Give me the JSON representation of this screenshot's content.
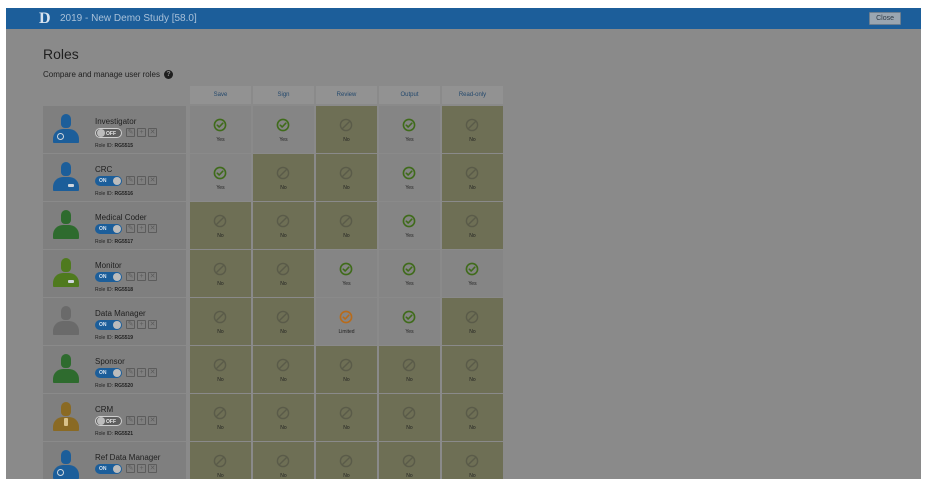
{
  "header": {
    "logo": "D",
    "app_title": "2019 - New Demo Study [58.0]",
    "close_label": "Close"
  },
  "page": {
    "title": "Roles",
    "subtitle": "Compare and manage user roles",
    "help_glyph": "?"
  },
  "columns": [
    "Save",
    "Sign",
    "Review",
    "Output",
    "Read-only"
  ],
  "role_id_prefix": "Role ID:",
  "colors": {
    "accent": "#1c5e9a",
    "yes_check": "#3f6b1a",
    "limited_check": "#b86b1a",
    "no_mark": "#5a5b49"
  },
  "roles": [
    {
      "name": "Investigator",
      "toggle": "OFF",
      "role_id": "RG5515",
      "avatar_color": "#1c5e9a",
      "avatar": "doctor",
      "cells": [
        {
          "status": "yes",
          "label": "Yes"
        },
        {
          "status": "yes",
          "label": "Yes"
        },
        {
          "status": "no",
          "label": "No"
        },
        {
          "status": "yes",
          "label": "Yes"
        },
        {
          "status": "no",
          "label": "No"
        }
      ]
    },
    {
      "name": "CRC",
      "toggle": "ON",
      "role_id": "RG5516",
      "avatar_color": "#1c5e9a",
      "avatar": "badge",
      "cells": [
        {
          "status": "yes",
          "label": "Yes"
        },
        {
          "status": "no",
          "label": "No"
        },
        {
          "status": "no",
          "label": "No"
        },
        {
          "status": "yes",
          "label": "Yes"
        },
        {
          "status": "no",
          "label": "No"
        }
      ]
    },
    {
      "name": "Medical Coder",
      "toggle": "ON",
      "role_id": "RG5517",
      "avatar_color": "#2e6b2e",
      "avatar": "plain",
      "cells": [
        {
          "status": "no",
          "label": "No"
        },
        {
          "status": "no",
          "label": "No"
        },
        {
          "status": "no",
          "label": "No"
        },
        {
          "status": "yes",
          "label": "Yes"
        },
        {
          "status": "no",
          "label": "No"
        }
      ]
    },
    {
      "name": "Monitor",
      "toggle": "ON",
      "role_id": "RG5518",
      "avatar_color": "#4f7a1e",
      "avatar": "badge",
      "cells": [
        {
          "status": "no",
          "label": "No"
        },
        {
          "status": "no",
          "label": "No"
        },
        {
          "status": "yes",
          "label": "Yes"
        },
        {
          "status": "yes",
          "label": "Yes"
        },
        {
          "status": "yes",
          "label": "Yes"
        }
      ]
    },
    {
      "name": "Data Manager",
      "toggle": "ON",
      "role_id": "RG5519",
      "avatar_color": "#6a6a6a",
      "avatar": "plain",
      "cells": [
        {
          "status": "no",
          "label": "No"
        },
        {
          "status": "no",
          "label": "No"
        },
        {
          "status": "limited",
          "label": "Limited"
        },
        {
          "status": "yes",
          "label": "Yes"
        },
        {
          "status": "no",
          "label": "No"
        }
      ]
    },
    {
      "name": "Sponsor",
      "toggle": "ON",
      "role_id": "RG5520",
      "avatar_color": "#2e6b2e",
      "avatar": "plain",
      "cells": [
        {
          "status": "no",
          "label": "No"
        },
        {
          "status": "no",
          "label": "No"
        },
        {
          "status": "no",
          "label": "No"
        },
        {
          "status": "no",
          "label": "No"
        },
        {
          "status": "no",
          "label": "No"
        }
      ]
    },
    {
      "name": "CRM",
      "toggle": "OFF",
      "role_id": "RG5521",
      "avatar_color": "#8a6a24",
      "avatar": "tie",
      "cells": [
        {
          "status": "no",
          "label": "No"
        },
        {
          "status": "no",
          "label": "No"
        },
        {
          "status": "no",
          "label": "No"
        },
        {
          "status": "no",
          "label": "No"
        },
        {
          "status": "no",
          "label": "No"
        }
      ]
    },
    {
      "name": "Ref Data Manager",
      "toggle": "ON",
      "role_id": "",
      "avatar_color": "#1c5e9a",
      "avatar": "doctor",
      "cells": [
        {
          "status": "no",
          "label": "No"
        },
        {
          "status": "no",
          "label": "No"
        },
        {
          "status": "no",
          "label": "No"
        },
        {
          "status": "no",
          "label": "No"
        },
        {
          "status": "no",
          "label": "No"
        }
      ]
    }
  ]
}
